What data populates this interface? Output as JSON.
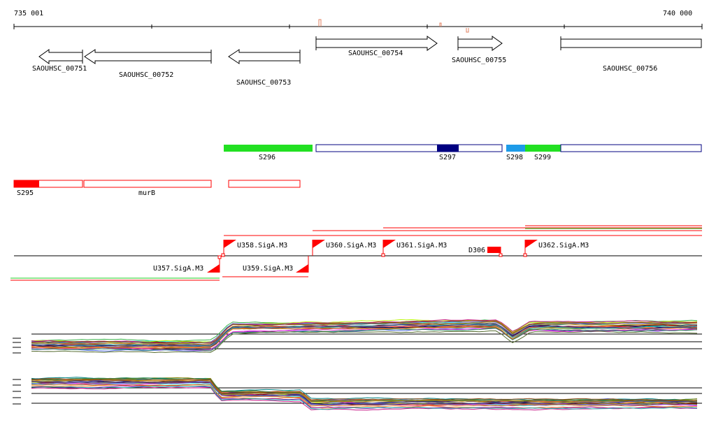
{
  "axis": {
    "start_label": "735 001",
    "end_label": "740 000"
  },
  "genes": [
    {
      "label": "SAOUHSC_00751",
      "strand": "-"
    },
    {
      "label": "SAOUHSC_00752",
      "strand": "-"
    },
    {
      "label": "SAOUHSC_00753",
      "strand": "-"
    },
    {
      "label": "SAOUHSC_00754",
      "strand": "+"
    },
    {
      "label": "SAOUHSC_00755",
      "strand": "+"
    },
    {
      "label": "SAOUHSC_00756",
      "strand": "+"
    }
  ],
  "segments_upper": [
    {
      "label": "S296",
      "color": "#22e022"
    },
    {
      "label": "S297",
      "color": "#000080"
    },
    {
      "label": "S298",
      "color": "#1e9be8"
    },
    {
      "label": "S299",
      "color": "#22e022"
    }
  ],
  "segments_lower": [
    {
      "label": "S295",
      "color": "#ff0000"
    },
    {
      "label": "murB",
      "color": "#ff0000"
    }
  ],
  "features_top": [
    {
      "label": "U358.SigA.M3"
    },
    {
      "label": "U360.SigA.M3"
    },
    {
      "label": "U361.SigA.M3"
    },
    {
      "label": "D306"
    },
    {
      "label": "U362.SigA.M3"
    }
  ],
  "features_bottom": [
    {
      "label": "U357.SigA.M3"
    },
    {
      "label": "U359.SigA.M3"
    }
  ],
  "colors": {
    "gene_outline": "#000000",
    "feature_red": "#ff0000",
    "feature_green": "#22cc22",
    "track_outline_blue": "#000080"
  }
}
